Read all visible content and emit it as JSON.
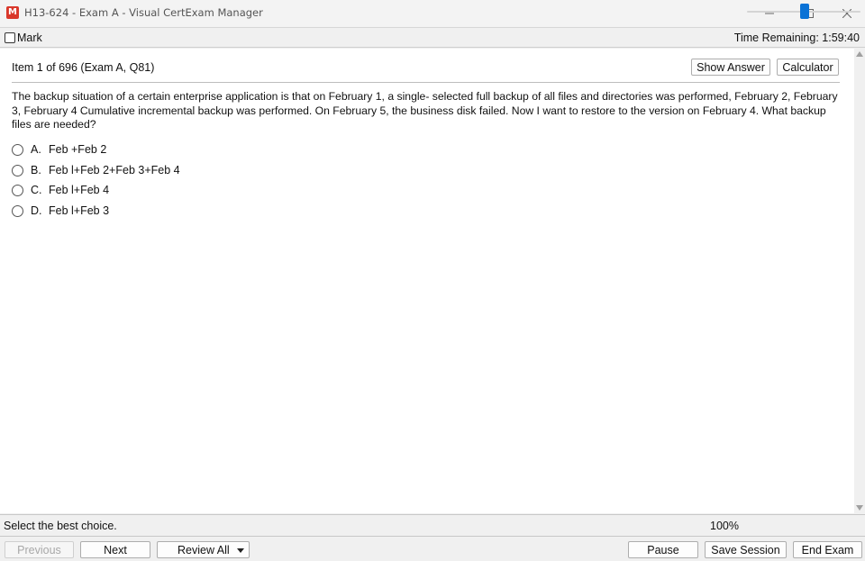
{
  "window": {
    "title": "H13-624 - Exam A - Visual CertExam Manager",
    "icon_letter": "M",
    "icon_color": "#d9372a"
  },
  "topbar": {
    "mark_label": "Mark",
    "time_remaining": "Time Remaining: 1:59:40"
  },
  "item": {
    "header": "Item 1 of 696  (Exam A, Q81)",
    "show_answer_label": "Show Answer",
    "calculator_label": "Calculator"
  },
  "question": {
    "text": "The backup situation of a certain enterprise application is that on February 1, a single- selected full backup of all files and directories was performed, February 2, February 3, February 4 Cumulative incremental backup was performed. On February 5, the business disk failed. Now I want to restore to the version on February 4. What backup files are needed?",
    "choices": [
      {
        "letter": "A.",
        "text": "Feb +Feb 2"
      },
      {
        "letter": "B.",
        "text": "Feb l+Feb 2+Feb 3+Feb 4"
      },
      {
        "letter": "C.",
        "text": "Feb l+Feb 4"
      },
      {
        "letter": "D.",
        "text": "Feb l+Feb 3"
      }
    ]
  },
  "status": {
    "instruction": "Select the best choice.",
    "zoom": "100%",
    "accent_color": "#0a72d6"
  },
  "nav": {
    "previous": "Previous",
    "next": "Next",
    "review_all": "Review All",
    "pause": "Pause",
    "save_session": "Save Session",
    "end_exam": "End Exam"
  }
}
